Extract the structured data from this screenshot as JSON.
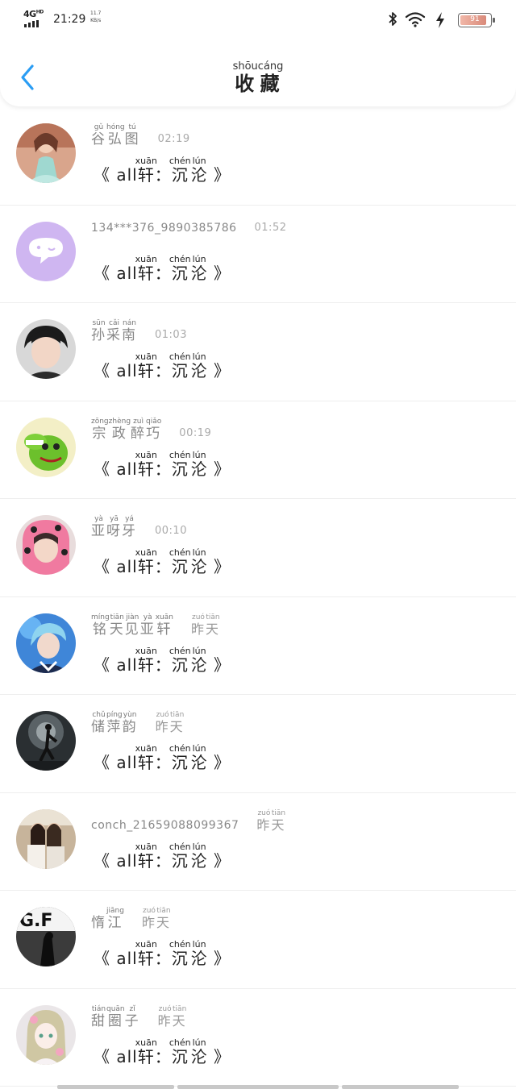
{
  "status_bar": {
    "network": "4G",
    "network_sup": "HD",
    "time": "21:29",
    "speed_value": "11.7",
    "speed_unit": "KB/s",
    "battery_level": "91"
  },
  "header": {
    "title": [
      {
        "char": "收",
        "pinyin": "shōu"
      },
      {
        "char": "藏",
        "pinyin": "cáng"
      }
    ]
  },
  "content_template": {
    "open": "《",
    "prefix": "all",
    "name_char": "轩",
    "name_pinyin": "xuān",
    "colon": "：",
    "c1": "沉",
    "p1": "chén",
    "c2": "沦",
    "p2": "lún",
    "close": "》"
  },
  "items": [
    {
      "name_ruby": [
        {
          "c": "谷",
          "p": "gǔ"
        },
        {
          "c": "弘",
          "p": "hóng"
        },
        {
          "c": "图",
          "p": "tú"
        }
      ],
      "time": "02:19"
    },
    {
      "account": "134***376_9890385786",
      "time": "01:52"
    },
    {
      "name_ruby": [
        {
          "c": "孙",
          "p": "sūn"
        },
        {
          "c": "采",
          "p": "cǎi"
        },
        {
          "c": "南",
          "p": "nán"
        }
      ],
      "time": "01:03"
    },
    {
      "name_ruby": [
        {
          "c": "宗",
          "p": "zōng"
        },
        {
          "c": "政",
          "p": "zhèng"
        },
        {
          "c": "醉",
          "p": "zuì"
        },
        {
          "c": "巧",
          "p": "qiǎo"
        }
      ],
      "time": "00:19"
    },
    {
      "name_ruby": [
        {
          "c": "亚",
          "p": "yà"
        },
        {
          "c": "呀",
          "p": "yā"
        },
        {
          "c": "牙",
          "p": "yá"
        }
      ],
      "time": "00:10"
    },
    {
      "name_ruby": [
        {
          "c": "铭",
          "p": "míng"
        },
        {
          "c": "天",
          "p": "tiān"
        },
        {
          "c": "见",
          "p": "jiàn"
        },
        {
          "c": "亚",
          "p": "yà"
        },
        {
          "c": "轩",
          "p": "xuān"
        }
      ],
      "time_ruby": [
        {
          "c": "昨",
          "p": "zuó"
        },
        {
          "c": "天",
          "p": "tiān"
        }
      ]
    },
    {
      "name_ruby": [
        {
          "c": "储",
          "p": "chǔ"
        },
        {
          "c": "萍",
          "p": "píng"
        },
        {
          "c": "韵",
          "p": "yùn"
        }
      ],
      "time_ruby": [
        {
          "c": "昨",
          "p": "zuó"
        },
        {
          "c": "天",
          "p": "tiān"
        }
      ]
    },
    {
      "account": "conch_21659088099367",
      "time_ruby": [
        {
          "c": "昨",
          "p": "zuó"
        },
        {
          "c": "天",
          "p": "tiān"
        }
      ]
    },
    {
      "name_ruby": [
        {
          "c": "惰",
          "p": ""
        },
        {
          "c": "江",
          "p": "jiāng"
        }
      ],
      "time_ruby": [
        {
          "c": "昨",
          "p": "zuó"
        },
        {
          "c": "天",
          "p": "tiān"
        }
      ]
    },
    {
      "name_ruby": [
        {
          "c": "甜",
          "p": "tián"
        },
        {
          "c": "圈",
          "p": "quān"
        },
        {
          "c": "子",
          "p": "zǐ"
        }
      ],
      "time_ruby": [
        {
          "c": "昨",
          "p": "zuó"
        },
        {
          "c": "天",
          "p": "tiān"
        }
      ]
    }
  ],
  "colors": {
    "back_arrow": "#2a9df4",
    "name_text": "#888888",
    "time_text": "#aaaaaa",
    "divider": "#eeeeee"
  },
  "icons": [
    "back-arrow-icon",
    "bluetooth-icon",
    "wifi-icon",
    "charging-icon",
    "battery-icon",
    "signal-icon"
  ]
}
